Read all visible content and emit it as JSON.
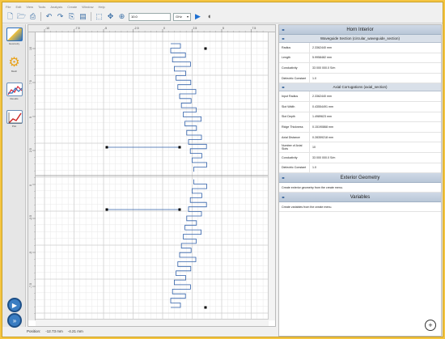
{
  "menubar": [
    "File",
    "Edit",
    "View",
    "Tools",
    "Analysis",
    "Create",
    "Window",
    "Help"
  ],
  "toolbar": {
    "zoom_value": "10.0",
    "unit_select": "GHz",
    "icons": [
      "new-icon",
      "open-icon",
      "print-icon",
      "undo-icon",
      "redo-icon",
      "copy-icon",
      "paste-icon",
      "select-icon",
      "move-icon",
      "zoom-icon",
      "play-icon",
      "sound-icon"
    ]
  },
  "leftpanel": {
    "items": [
      {
        "label": "Geometry",
        "icon": "geometry-icon"
      },
      {
        "label": "Mesh",
        "icon": "gear-icon"
      },
      {
        "label": "Results",
        "icon": "chart-icon"
      },
      {
        "label": "Plot",
        "icon": "plot-icon"
      }
    ]
  },
  "ruler": {
    "top_ticks": [
      "-10",
      "-7.5",
      "-5",
      "-2.5",
      "0",
      "2.5",
      "5",
      "7.5"
    ],
    "left_ticks": [
      "10",
      "7.5",
      "5",
      "2.5",
      "0",
      "-2.5",
      "-5",
      "-7.5"
    ]
  },
  "status": {
    "label": "Position:",
    "x": "-12.73 mm",
    "y": "-4.21 mm"
  },
  "rightpanel": {
    "title": "Horn Interior",
    "waveguide": {
      "heading": "Waveguide Section (circular_waveguide_section)",
      "rows": [
        {
          "name": "Radius",
          "value": "2.3362440 mm"
        },
        {
          "name": "Length",
          "value": "5.9958482 mm"
        },
        {
          "name": "Conductivity",
          "value": "33 000 000.0 S/m"
        },
        {
          "name": "Dielectric Constant",
          "value": "1.0"
        }
      ]
    },
    "corrugations": {
      "heading": "Axial Corrugations (axial_section)",
      "rows": [
        {
          "name": "Input Radius",
          "value": "2.3362440 mm"
        },
        {
          "name": "Slot Width",
          "value": "0.43554491 mm"
        },
        {
          "name": "Slot Depth",
          "value": "1.4989623 mm"
        },
        {
          "name": "Ridge Thickness",
          "value": "0.15190868 mm"
        },
        {
          "name": "Axial Distance",
          "value": "0.28359218 mm"
        },
        {
          "name": "Number of Axial Slots",
          "value": "10"
        },
        {
          "name": "Conductivity",
          "value": "33 000 000.0 S/m"
        },
        {
          "name": "Dielectric Constant",
          "value": "1.0"
        }
      ]
    },
    "exterior": {
      "heading": "Exterior Geometry",
      "note": "Create exterior geometry from the create menu."
    },
    "variables": {
      "heading": "Variables",
      "note": "Create variables from the create menu."
    }
  }
}
